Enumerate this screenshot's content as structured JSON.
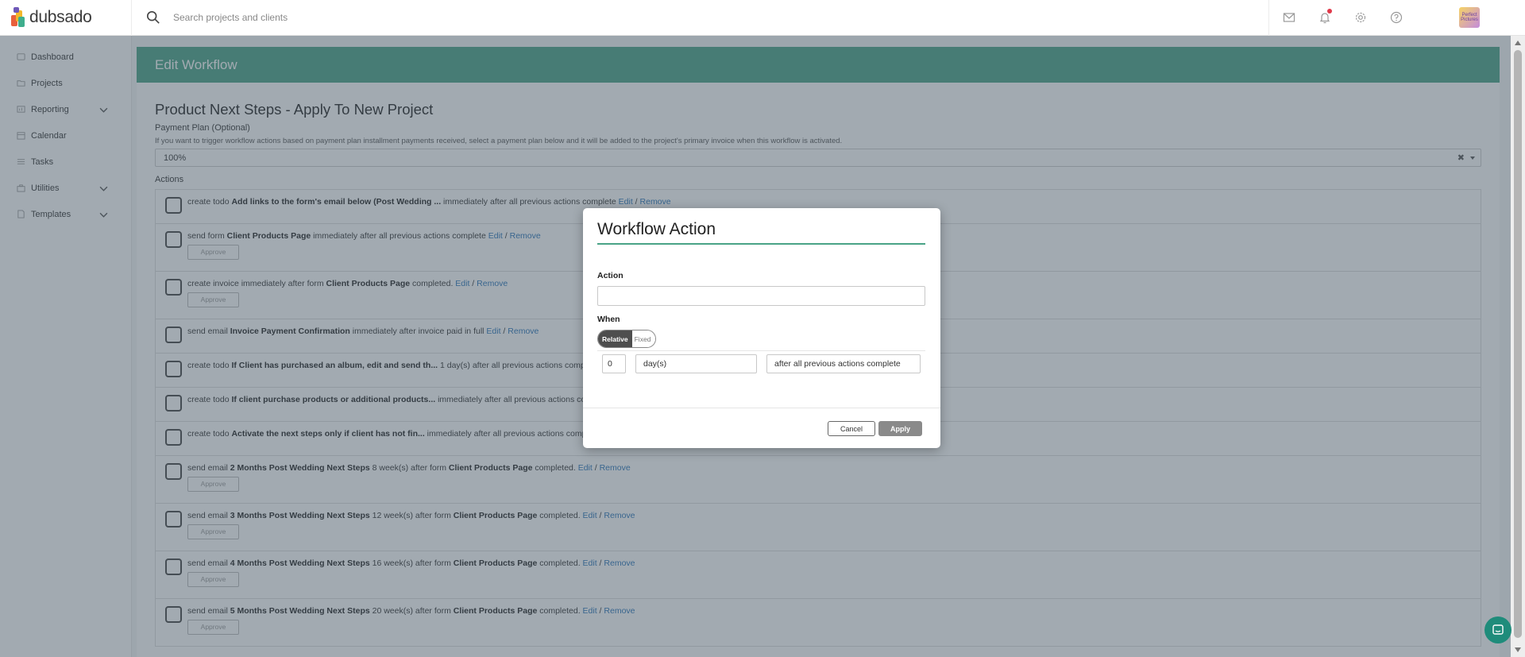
{
  "app": {
    "logo_text": "dubsado",
    "search_placeholder": "Search projects and clients",
    "avatar_text": "Perfect Pictures"
  },
  "sidebar": {
    "items": [
      {
        "label": "Dashboard",
        "icon": "dashboard-icon",
        "expandable": false
      },
      {
        "label": "Projects",
        "icon": "projects-icon",
        "expandable": false
      },
      {
        "label": "Reporting",
        "icon": "reporting-icon",
        "expandable": true
      },
      {
        "label": "Calendar",
        "icon": "calendar-icon",
        "expandable": false
      },
      {
        "label": "Tasks",
        "icon": "tasks-icon",
        "expandable": false
      },
      {
        "label": "Utilities",
        "icon": "utilities-icon",
        "expandable": true
      },
      {
        "label": "Templates",
        "icon": "templates-icon",
        "expandable": true
      }
    ]
  },
  "main": {
    "header": "Edit Workflow",
    "workflow_title": "Product Next Steps - Apply To New Project",
    "payment_plan_label": "Payment Plan (Optional)",
    "payment_plan_help": "If you want to trigger workflow actions based on payment plan installment payments received, select a payment plan below and it will be added to the project's primary invoice when this workflow is activated.",
    "payment_plan_value": "100%",
    "actions_label": "Actions",
    "edit_label": "Edit",
    "remove_label": "Remove",
    "approve_label": "Approve",
    "actions": [
      {
        "pre": "create todo ",
        "bold": "Add links to the form's email below (Post Wedding ...",
        "post": " immediately after all previous actions complete",
        "bold2": "",
        "post2": "",
        "approve": false,
        "links": true
      },
      {
        "pre": "send form ",
        "bold": "Client Products Page",
        "post": " immediately after all previous actions complete",
        "bold2": "",
        "post2": "",
        "approve": true,
        "links": true
      },
      {
        "pre": "create invoice immediately after form ",
        "bold": "Client Products Page",
        "post": " completed.",
        "bold2": "",
        "post2": "",
        "approve": true,
        "links": true
      },
      {
        "pre": "send email ",
        "bold": "Invoice Payment Confirmation",
        "post": " immediately after invoice paid in full",
        "bold2": "",
        "post2": "",
        "approve": false,
        "links": true
      },
      {
        "pre": "create todo ",
        "bold": "If Client has purchased an album, edit and send th...",
        "post": " 1 day(s) after all previous actions complete",
        "bold2": "",
        "post2": "",
        "approve": false,
        "links": false
      },
      {
        "pre": "create todo ",
        "bold": "If client purchase products or additional products...",
        "post": " immediately after all previous actions comp",
        "bold2": "",
        "post2": "",
        "approve": false,
        "links": false
      },
      {
        "pre": "create todo ",
        "bold": "Activate the next steps only if client has not fin...",
        "post": " immediately after all previous actions complete",
        "bold2": "",
        "post2": "",
        "approve": false,
        "links": false
      },
      {
        "pre": "send email ",
        "bold": "2 Months Post Wedding Next Steps",
        "post": " 8 week(s) after form ",
        "bold2": "Client Products Page",
        "post2": " completed.",
        "approve": true,
        "links": true
      },
      {
        "pre": "send email ",
        "bold": "3 Months Post Wedding Next Steps",
        "post": " 12 week(s) after form ",
        "bold2": "Client Products Page",
        "post2": " completed.",
        "approve": true,
        "links": true
      },
      {
        "pre": "send email ",
        "bold": "4 Months Post Wedding Next Steps",
        "post": " 16 week(s) after form ",
        "bold2": "Client Products Page",
        "post2": " completed.",
        "approve": true,
        "links": true
      },
      {
        "pre": "send email ",
        "bold": "5 Months Post Wedding Next Steps",
        "post": " 20 week(s) after form ",
        "bold2": "Client Products Page",
        "post2": " completed.",
        "approve": true,
        "links": true
      }
    ]
  },
  "modal": {
    "title": "Workflow Action",
    "action_label": "Action",
    "action_value": "",
    "when_label": "When",
    "toggle_on": "Relative",
    "toggle_off": "Fixed",
    "amount": "0",
    "unit": "day(s)",
    "trigger": "after all previous actions complete",
    "cancel": "Cancel",
    "apply": "Apply"
  },
  "colors": {
    "accent": "#49a386",
    "link": "#2a74b8",
    "notification": "#e0394a",
    "chat": "#1f8c7b"
  }
}
